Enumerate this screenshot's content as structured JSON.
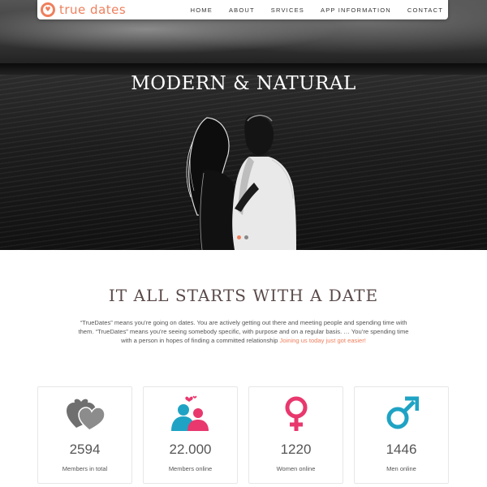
{
  "colors": {
    "accent": "#ef7f5c",
    "pink": "#e8386e",
    "blue": "#1fa3c4",
    "gray": "#6f6f6f"
  },
  "brand": {
    "name": "true dates",
    "icon": "heart-location-icon"
  },
  "nav": {
    "items": [
      {
        "label": "HOME"
      },
      {
        "label": "ABOUT"
      },
      {
        "label": "SRVICES"
      },
      {
        "label": "APP INFORMATION"
      },
      {
        "label": "CONTACT"
      }
    ]
  },
  "hero": {
    "title": "MODERN & NATURAL",
    "slides": {
      "count": 2,
      "active": 1
    }
  },
  "intro": {
    "title": "IT ALL STARTS WITH A DATE",
    "text": "“TrueDates” means you’re going on dates. You are actively getting out there and meeting people and spending time with them. “TrueDates” means you’re seeing somebody specific, with purpose and on a regular basis. … You’re spending time with a person in hopes of finding a committed relationship",
    "highlight": "Joining us today just got easier!"
  },
  "stats": [
    {
      "icon": "hearts-icon",
      "value": "2594",
      "label": "Members in total"
    },
    {
      "icon": "couple-icon",
      "value": "22.000",
      "label": "Members online"
    },
    {
      "icon": "female-symbol-icon",
      "value": "1220",
      "label": "Women online"
    },
    {
      "icon": "male-symbol-icon",
      "value": "1446",
      "label": "Men online"
    }
  ]
}
